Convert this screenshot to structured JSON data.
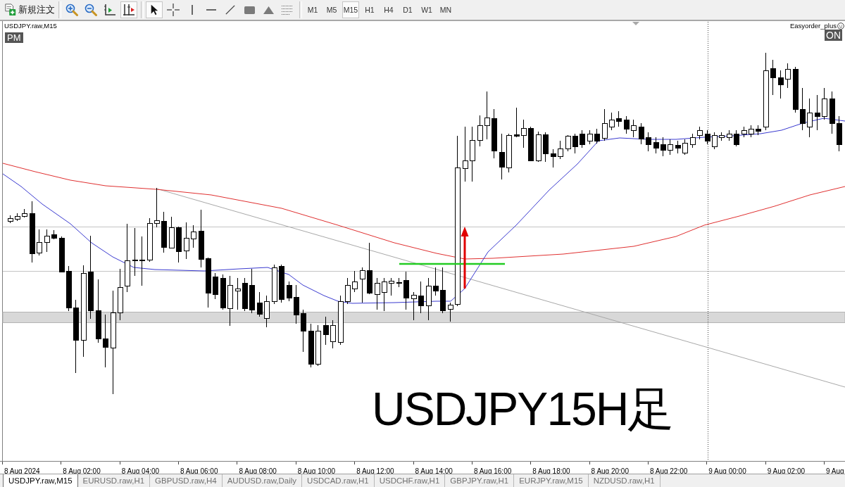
{
  "toolbar": {
    "new_order_button": {
      "label": "新規注文"
    },
    "chart_tools": [
      {
        "kind": "zoomin",
        "selected": false
      },
      {
        "kind": "zoomout",
        "selected": false
      },
      {
        "kind": "shift",
        "selected": false
      },
      {
        "kind": "autoscroll",
        "selected": true
      }
    ],
    "drawing_tools": [
      {
        "kind": "cursor",
        "selected": true
      },
      {
        "kind": "crosshair",
        "selected": false
      },
      {
        "kind": "vline",
        "selected": false
      },
      {
        "kind": "hline",
        "selected": false
      },
      {
        "kind": "trendline",
        "selected": false
      },
      {
        "kind": "rectangle",
        "selected": false
      },
      {
        "kind": "triangle",
        "selected": false
      },
      {
        "kind": "fibo",
        "selected": false
      }
    ],
    "timeframes": [
      {
        "label": "M1",
        "selected": false
      },
      {
        "label": "M5",
        "selected": false
      },
      {
        "label": "M15",
        "selected": true
      },
      {
        "label": "H1",
        "selected": false
      },
      {
        "label": "H4",
        "selected": false
      },
      {
        "label": "D1",
        "selected": false
      },
      {
        "label": "W1",
        "selected": false
      },
      {
        "label": "MN",
        "selected": false
      }
    ]
  },
  "chart": {
    "title": "USDJPY.raw,M15",
    "session_badge": "PM",
    "expert": {
      "name": "Easyorder_plus",
      "status": "ON"
    },
    "caption": "USDJPY15H足",
    "time_axis": [
      "8 Aug 2024",
      "8 Aug 02:00",
      "8 Aug 04:00",
      "8 Aug 06:00",
      "8 Aug 08:00",
      "8 Aug 10:00",
      "8 Aug 12:00",
      "8 Aug 14:00",
      "8 Aug 16:00",
      "8 Aug 18:00",
      "8 Aug 20:00",
      "8 Aug 22:00",
      "9 Aug 00:00",
      "9 Aug 02:00",
      "9 Aug"
    ]
  },
  "symbol_tabs": [
    {
      "label": "USDJPY.raw,M15",
      "selected": true
    },
    {
      "label": "EURUSD.raw,H1",
      "selected": false
    },
    {
      "label": "GBPUSD.raw,H4",
      "selected": false
    },
    {
      "label": "AUDUSD.raw,Daily",
      "selected": false
    },
    {
      "label": "USDCAD.raw,H1",
      "selected": false
    },
    {
      "label": "USDCHF.raw,H1",
      "selected": false
    },
    {
      "label": "GBPJPY.raw,H1",
      "selected": false
    },
    {
      "label": "EURJPY.raw,M15",
      "selected": false
    },
    {
      "label": "NZDUSD.raw,H1",
      "selected": false
    }
  ]
}
